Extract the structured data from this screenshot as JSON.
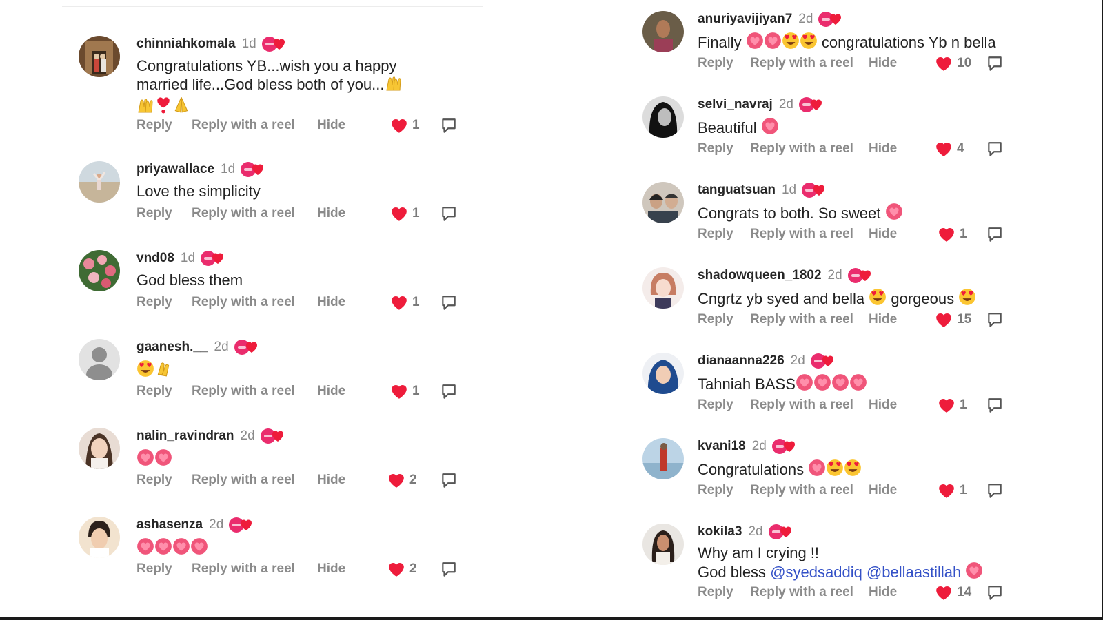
{
  "actions": {
    "reply": "Reply",
    "reply_reel": "Reply with a reel",
    "hide": "Hide"
  },
  "colors": {
    "heart": "#ee1c3b",
    "badge": "#ea2c6d",
    "mention": "#3451c7"
  },
  "left": [
    {
      "username": "chinniahkomala",
      "time": "1d",
      "text": "Congratulations YB...wish you a happy\nmarried life...God bless both of you...",
      "emojis": [
        "raised-hands",
        "raised-hands",
        "heart-exclamation",
        "folded-hands"
      ],
      "likes": "1"
    },
    {
      "username": "priyawallace",
      "time": "1d",
      "text": "Love the simplicity",
      "emojis": [],
      "likes": "1"
    },
    {
      "username": "vnd08",
      "time": "1d",
      "text": "God bless them",
      "emojis": [],
      "likes": "1"
    },
    {
      "username": "gaanesh.__",
      "time": "2d",
      "text": "",
      "emojis": [
        "heart-eyes",
        "clapping-hands"
      ],
      "likes": "1"
    },
    {
      "username": "nalin_ravindran",
      "time": "2d",
      "text": "",
      "emojis": [
        "heart",
        "heart"
      ],
      "likes": "2"
    },
    {
      "username": "ashasenza",
      "time": "2d",
      "text": "",
      "emojis": [
        "heart",
        "heart",
        "heart",
        "heart"
      ],
      "likes": "2"
    }
  ],
  "right": [
    {
      "username": "anuriyavijiyan7",
      "time": "2d",
      "text_before": "Finally",
      "emojis": [
        "heart",
        "heart",
        "heart-eyes",
        "heart-eyes"
      ],
      "text_after": "congratulations Yb n bella",
      "likes": "10"
    },
    {
      "username": "selvi_navraj",
      "time": "2d",
      "text_before": "Beautiful",
      "emojis": [
        "heart"
      ],
      "text_after": "",
      "likes": "4"
    },
    {
      "username": "tanguatsuan",
      "time": "1d",
      "text_before": "Congrats to both. So sweet",
      "emojis": [
        "heart"
      ],
      "text_after": "",
      "likes": "1"
    },
    {
      "username": "shadowqueen_1802",
      "time": "2d",
      "text_before": "Cngrtz yb syed and bella",
      "emojis": [
        "heart-eyes"
      ],
      "text_after": "gorgeous",
      "emojis_after": [
        "heart-eyes"
      ],
      "likes": "15"
    },
    {
      "username": "dianaanna226",
      "time": "2d",
      "text_before": "Tahniah BASS",
      "emojis": [
        "heart",
        "heart",
        "heart",
        "heart"
      ],
      "text_after": "",
      "likes": "1"
    },
    {
      "username": "kvani18",
      "time": "2d",
      "text_before": "Congratulations",
      "emojis": [
        "heart",
        "heart-eyes",
        "heart-eyes"
      ],
      "text_after": "",
      "likes": "1"
    },
    {
      "username": "kokila3",
      "time": "2d",
      "line1": "Why am I crying !!",
      "line2_prefix": "God bless",
      "mention1": "@syedsaddiq",
      "mention2": "@bellaastillah",
      "emojis": [
        "heart"
      ],
      "likes": "14"
    }
  ]
}
